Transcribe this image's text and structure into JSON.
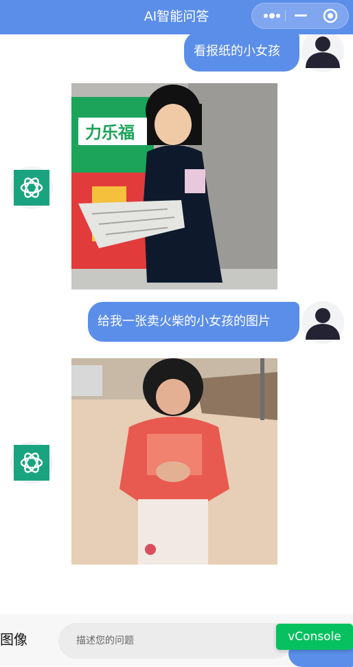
{
  "header": {
    "title": "AI智能问答",
    "capsule": {
      "more_icon": "ellipsis-icon",
      "minimize_icon": "minimize-icon",
      "close_icon": "target-circle-icon"
    }
  },
  "messages": [
    {
      "role": "user",
      "text": "看报纸的小女孩",
      "avatar_icon": "user-avatar-icon"
    },
    {
      "role": "ai",
      "avatar_icon": "openai-logo-icon",
      "image_description_icon": "generated-image"
    },
    {
      "role": "user",
      "text": "给我一张卖火柴的小女孩的图片",
      "avatar_icon": "user-avatar-icon"
    },
    {
      "role": "ai",
      "avatar_icon": "openai-logo-icon",
      "image_description_icon": "generated-image"
    }
  ],
  "footer": {
    "mode_label": "图像",
    "input_placeholder": "描述您的问题",
    "input_value": "",
    "vconsole_label": "vConsole"
  },
  "colors": {
    "primary": "#5b8ee9",
    "ai_avatar_bg": "#19a47f",
    "vconsole_green": "#07c160",
    "footer_bg": "#f7f7f7",
    "input_bg": "#ececec"
  }
}
